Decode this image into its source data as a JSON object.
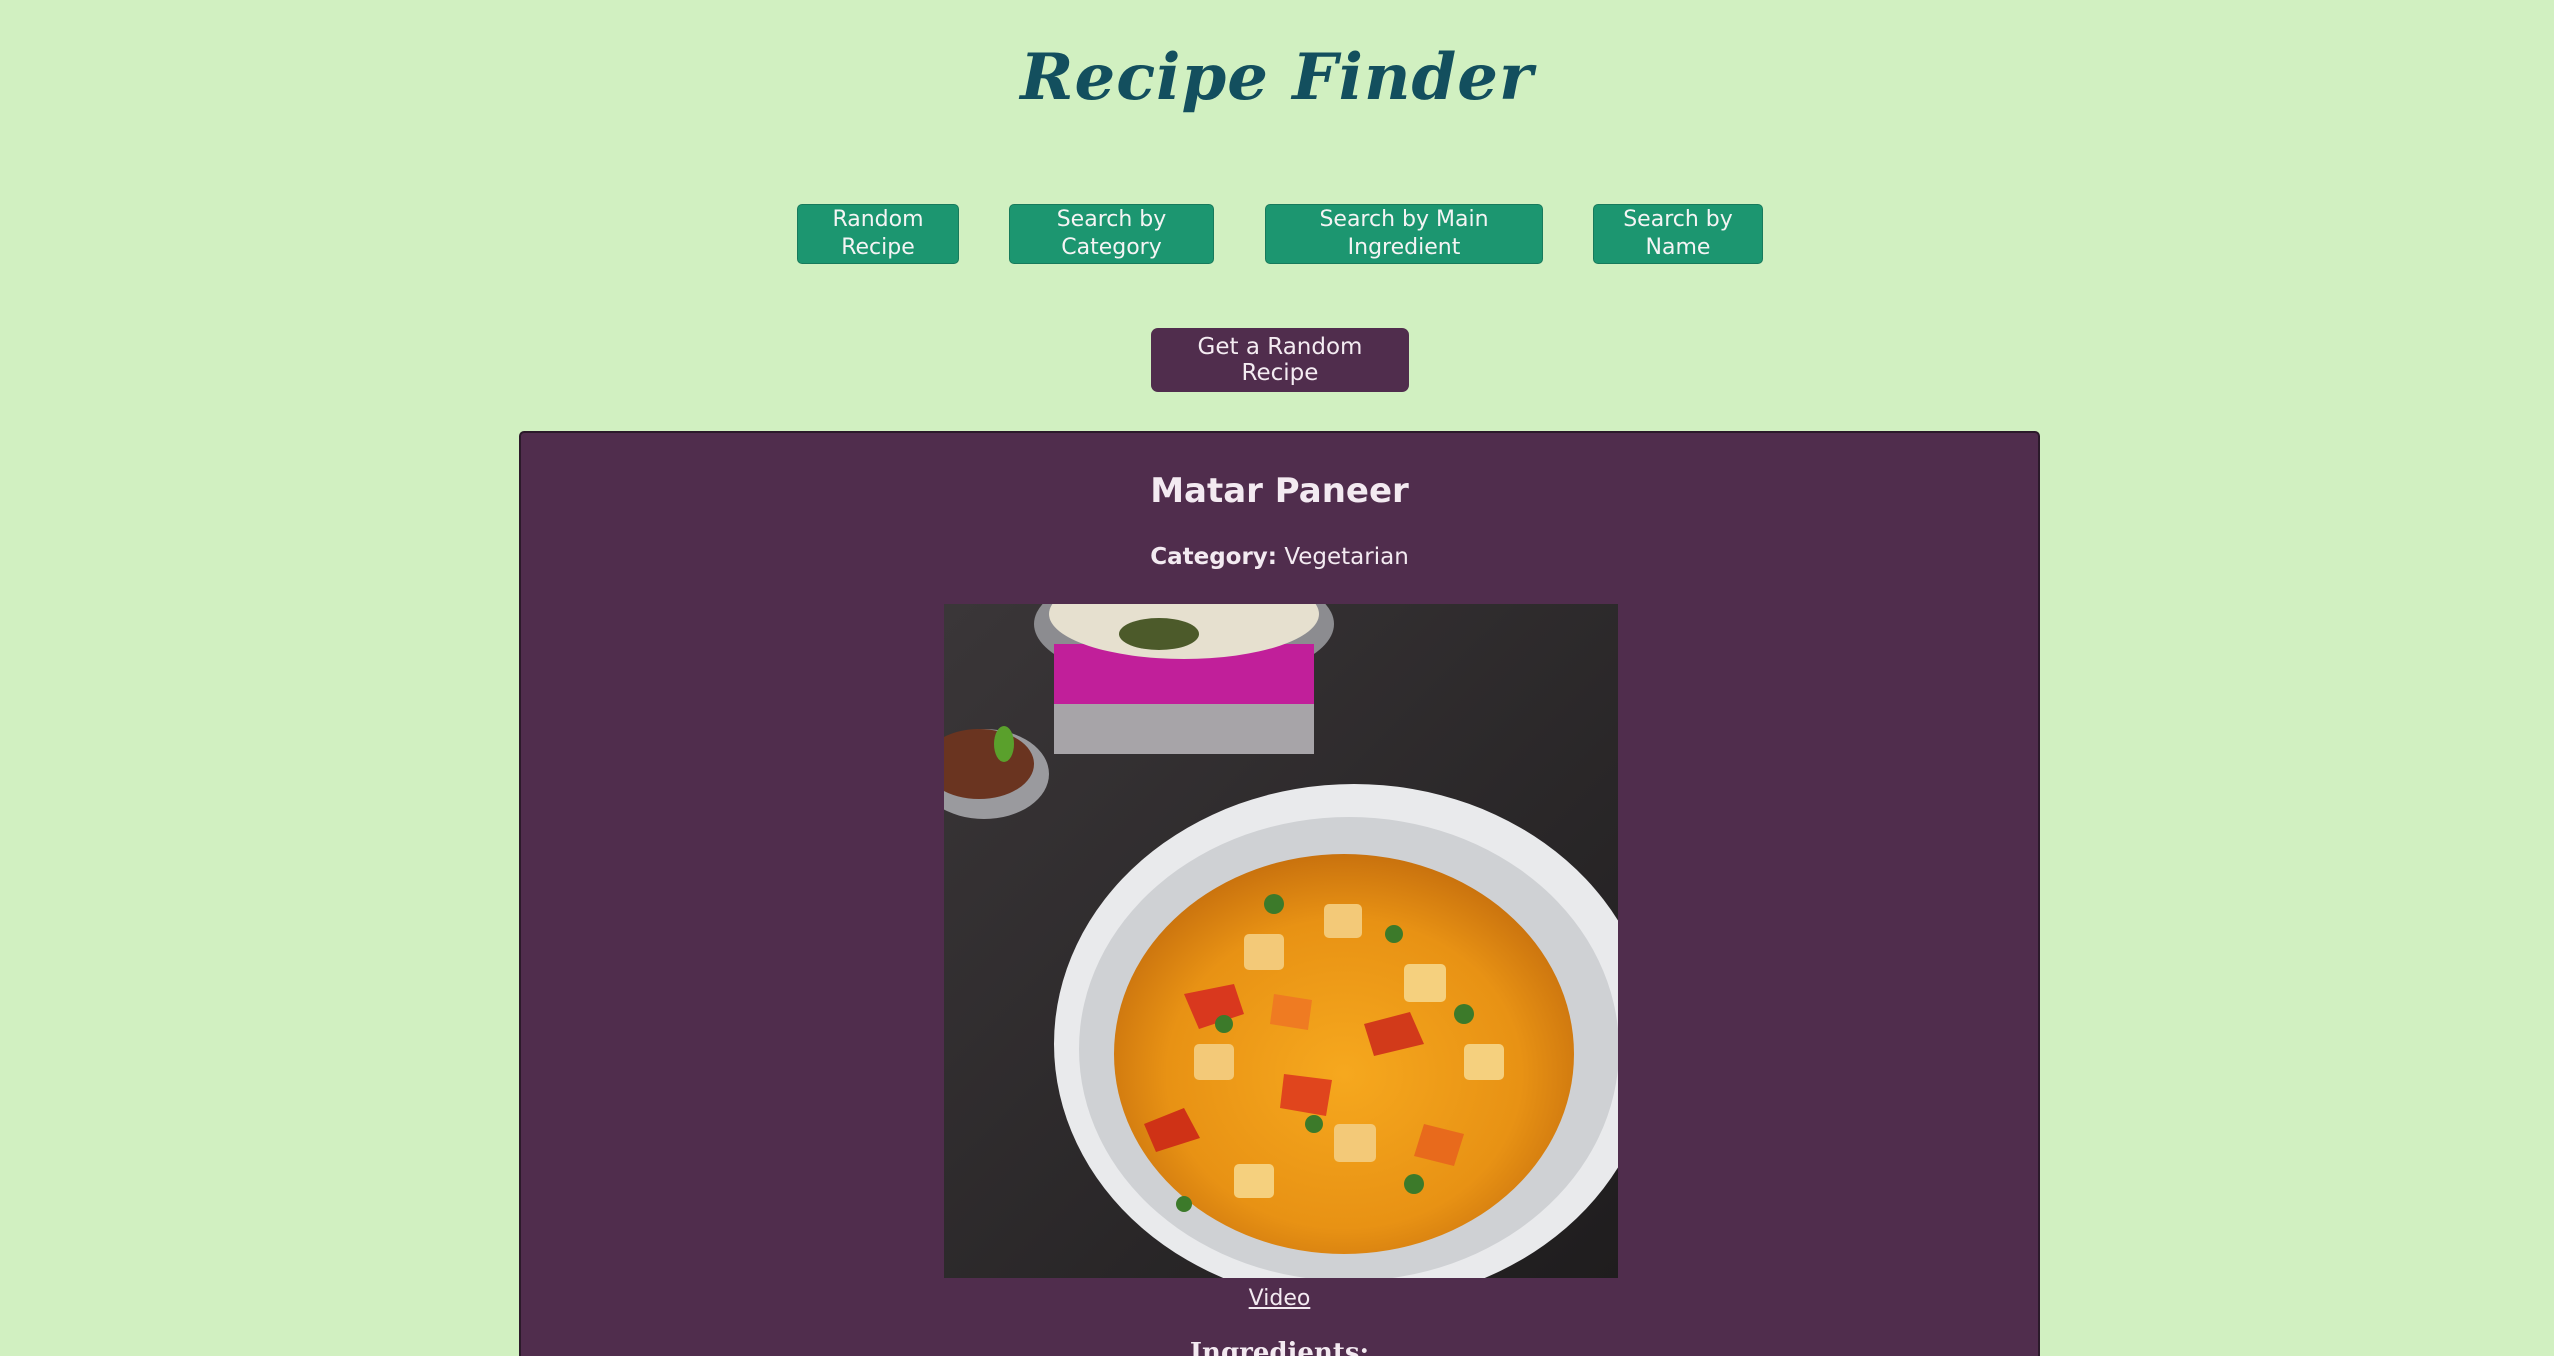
{
  "app": {
    "title": "Recipe Finder"
  },
  "nav": {
    "buttons": [
      {
        "label_line1": "Random",
        "label_line2": "Recipe"
      },
      {
        "label_line1": "Search by",
        "label_line2": "Category"
      },
      {
        "label_line1": "Search by Main",
        "label_line2": "Ingredient"
      },
      {
        "label_line1": "Search by",
        "label_line2": "Name"
      }
    ]
  },
  "action": {
    "random_label": "Get a Random Recipe"
  },
  "recipe": {
    "name": "Matar Paneer",
    "category_label": "Category:",
    "category_value": "Vegetarian",
    "video_label": "Video",
    "ingredients_heading": "Ingredients:"
  },
  "colors": {
    "page_bg": "#d1f0c1",
    "title": "#134f5e",
    "nav_button": "#1c9670",
    "accent_purple": "#502d4d"
  }
}
